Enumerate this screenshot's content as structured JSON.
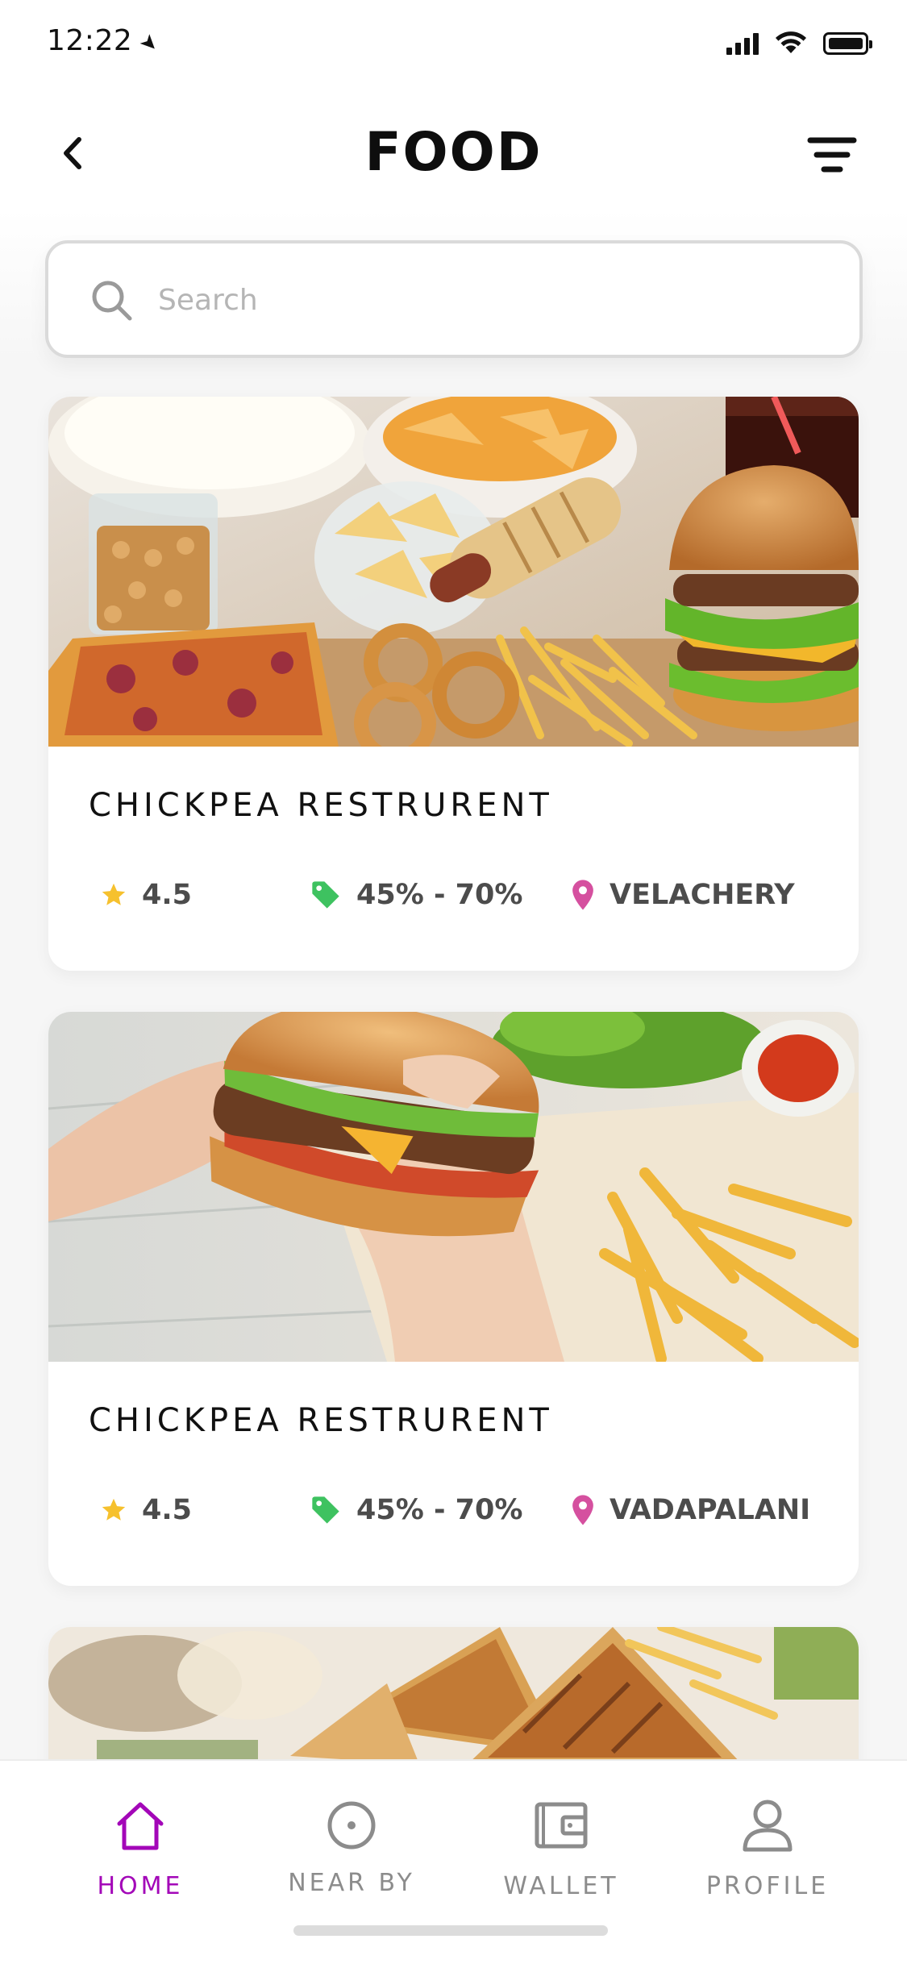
{
  "status_bar": {
    "time": "12:22",
    "location_icon": "location-arrow-icon",
    "icons": [
      "signal-icon",
      "wifi-icon",
      "battery-icon"
    ]
  },
  "header": {
    "title": "FOOD",
    "back_icon": "chevron-left-icon",
    "filter_icon": "filter-icon"
  },
  "search": {
    "placeholder": "Search",
    "value": "",
    "icon": "search-icon"
  },
  "restaurants": [
    {
      "name": "CHICKPEA RESTRURENT",
      "rating": "4.5",
      "discount": "45% - 70%",
      "location": "VELACHERY",
      "image": "fast-food-spread-photo"
    },
    {
      "name": "CHICKPEA RESTRURENT",
      "rating": "4.5",
      "discount": "45% - 70%",
      "location": "VADAPALANI",
      "image": "hands-holding-burger-photo"
    },
    {
      "image": "grilled-sandwich-photo"
    }
  ],
  "bottom_nav": {
    "items": [
      {
        "label": "HOME",
        "icon": "home-icon",
        "active": true
      },
      {
        "label": "NEAR BY",
        "icon": "target-icon",
        "active": false
      },
      {
        "label": "WALLET",
        "icon": "wallet-icon",
        "active": false
      },
      {
        "label": "PROFILE",
        "icon": "user-icon",
        "active": false
      }
    ]
  },
  "colors": {
    "accent": "#a307b8",
    "star": "#f6c12e",
    "tag": "#3ec260",
    "pin": "#d5509f",
    "text_dark": "#111111",
    "text_meta": "#4c4c4c",
    "nav_inactive": "#8c8c8c"
  }
}
